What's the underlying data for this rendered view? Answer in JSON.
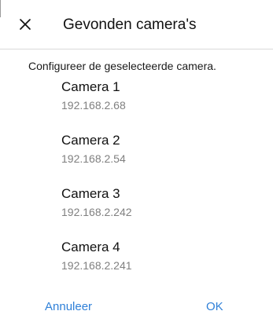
{
  "dialog": {
    "title": "Gevonden camera's",
    "close_icon": "close-icon",
    "instruction": "Configureer de geselecteerde camera.",
    "cameras": [
      {
        "name": "Camera 1",
        "ip": "192.168.2.68"
      },
      {
        "name": "Camera 2",
        "ip": "192.168.2.54"
      },
      {
        "name": "Camera 3",
        "ip": "192.168.2.242"
      },
      {
        "name": "Camera 4",
        "ip": "192.168.2.241"
      }
    ],
    "cancel_label": "Annuleer",
    "ok_label": "OK"
  },
  "colors": {
    "accent": "#2f80d8",
    "text": "#111111",
    "secondary_text": "#808080",
    "divider": "#d9d9d9",
    "background": "#ffffff"
  }
}
